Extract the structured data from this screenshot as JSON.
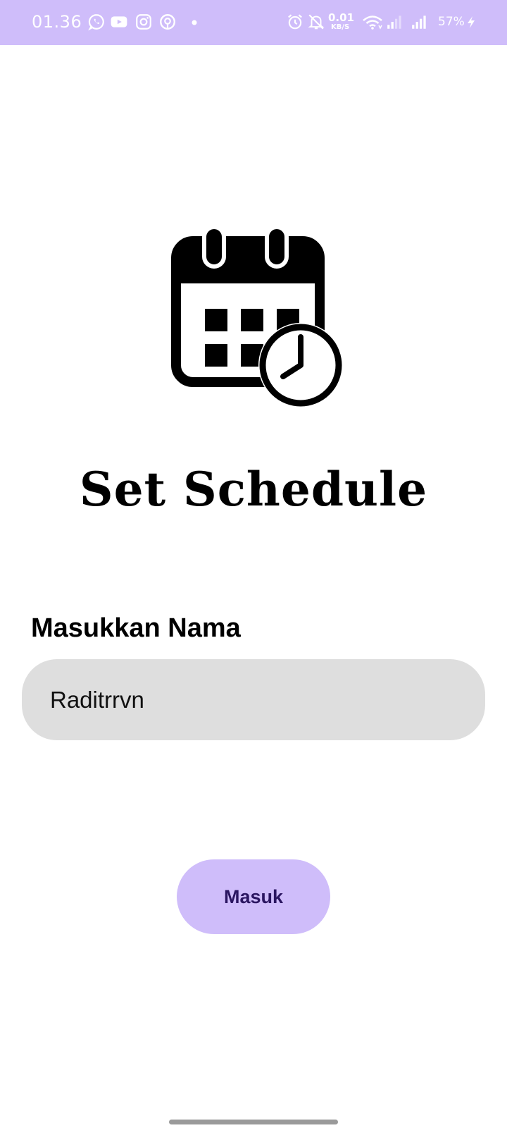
{
  "status_bar": {
    "time": "01.36",
    "left_icons": [
      "whatsapp-icon",
      "youtube-icon",
      "instagram-icon",
      "app-notification-icon",
      "more-dot-icon"
    ],
    "speed_value": "0.01",
    "speed_unit": "KB/S",
    "battery": "57%",
    "background": "#cfbdfa"
  },
  "main": {
    "icon": "calendar-clock-icon",
    "title": "Set Schedule",
    "name_label": "Masukkan Nama",
    "name_value": "Raditrrvn",
    "enter_button_label": "Masuk",
    "button_color": "#cfbdfa",
    "button_text_color": "#2b1661",
    "input_background": "#dedede"
  }
}
